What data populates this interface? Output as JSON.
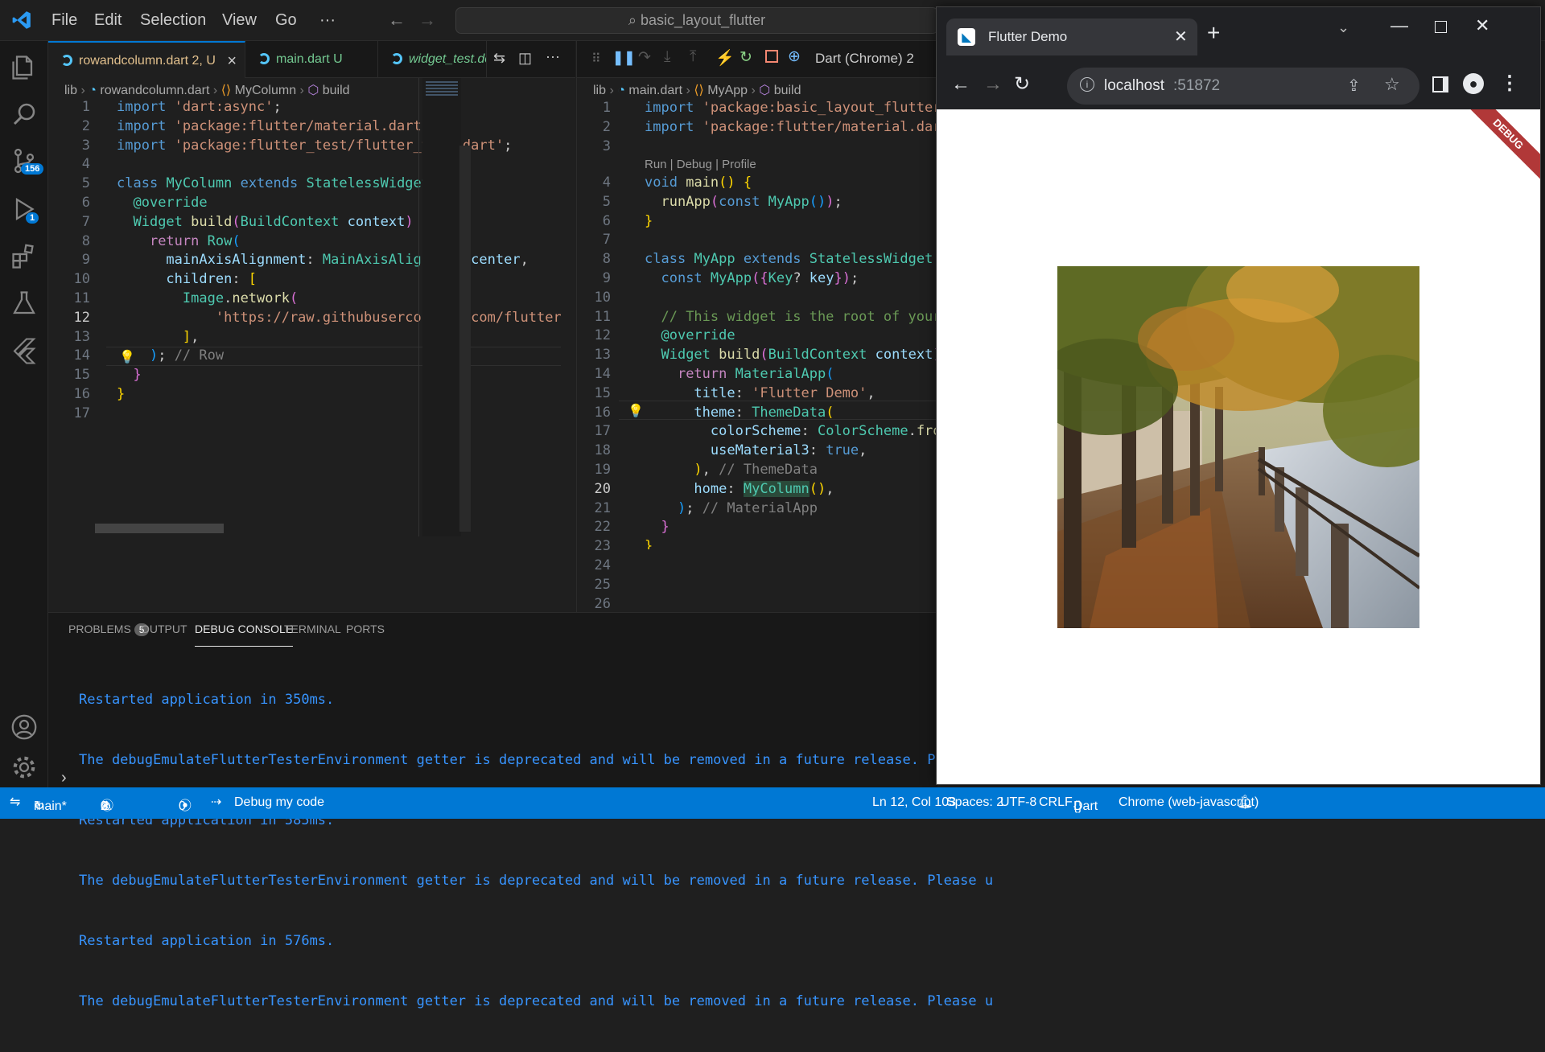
{
  "titlebar": {
    "menu": [
      "File",
      "Edit",
      "Selection",
      "View",
      "Go",
      "···"
    ],
    "search": "basic_layout_flutter"
  },
  "activity": {
    "scm_badge": "156",
    "debug_badge": "1"
  },
  "left_editor": {
    "tabs": [
      {
        "label": "rowandcolumn.dart",
        "suffix": "2, U",
        "close": "×"
      },
      {
        "label": "main.dart",
        "suffix": "U"
      },
      {
        "label": "widget_test.dc"
      }
    ],
    "breadcrumbs": [
      "lib",
      "rowandcolumn.dart",
      "MyColumn",
      "build"
    ],
    "line_numbers": [
      "1",
      "2",
      "3",
      "4",
      "5",
      "6",
      "7",
      "8",
      "9",
      "10",
      "11",
      "12",
      "13",
      "14",
      "15",
      "16",
      "17"
    ],
    "current_line": "12"
  },
  "right_editor": {
    "debug_target": "Dart (Chrome) 2",
    "breadcrumbs": [
      "lib",
      "main.dart",
      "MyApp",
      "build"
    ],
    "codelens": "Run | Debug | Profile",
    "line_numbers": [
      "1",
      "2",
      "3",
      "4",
      "5",
      "6",
      "7",
      "8",
      "9",
      "10",
      "11",
      "12",
      "13",
      "14",
      "15",
      "16",
      "17",
      "18",
      "19",
      "20",
      "21",
      "22",
      "23",
      "24",
      "25",
      "26"
    ],
    "current_line": "20"
  },
  "panel": {
    "tabs": [
      "PROBLEMS",
      "OUTPUT",
      "DEBUG CONSOLE",
      "TERMINAL",
      "PORTS"
    ],
    "problems_count": "5",
    "active_tab": "DEBUG CONSOLE",
    "lines": [
      "Restarted application in 350ms.",
      "The debugEmulateFlutterTesterEnvironment getter is deprecated and will be removed in a future release. Please u",
      "Restarted application in 585ms.",
      "The debugEmulateFlutterTesterEnvironment getter is deprecated and will be removed in a future release. Please u",
      "Restarted application in 576ms.",
      "The debugEmulateFlutterTesterEnvironment getter is deprecated and will be removed in a future release. Please u"
    ],
    "prompt": "›"
  },
  "statusbar": {
    "branch": "main*",
    "errors": "0",
    "warnings": "2",
    "infos": "3",
    "ports": "0",
    "debug": "Debug my code",
    "position": "Ln 12, Col 103",
    "spaces": "Spaces: 2",
    "encoding": "UTF-8",
    "eol": "CRLF",
    "language": "Dart",
    "device": "Chrome (web-javascript)"
  },
  "browser": {
    "tab_title": "Flutter Demo",
    "url_host": "localhost",
    "url_port": ":51872",
    "debug_banner": "DEBUG"
  }
}
